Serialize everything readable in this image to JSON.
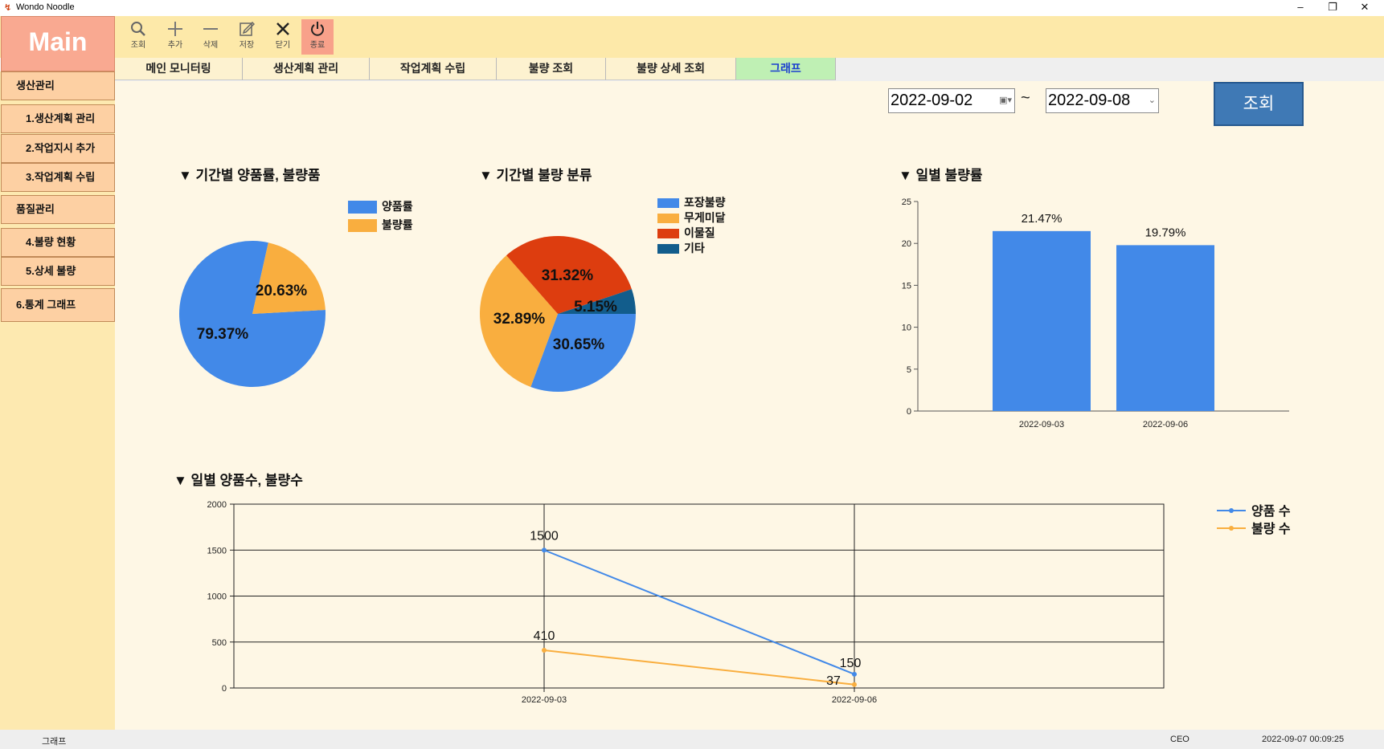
{
  "window": {
    "title": "Wondo Noodle",
    "controls": [
      "–",
      "❐",
      "✕"
    ]
  },
  "toolbar": {
    "logo": "Main",
    "buttons": [
      {
        "label": "조회",
        "icon": "search-icon"
      },
      {
        "label": "추가",
        "icon": "plus-icon"
      },
      {
        "label": "삭제",
        "icon": "minus-icon"
      },
      {
        "label": "저장",
        "icon": "save-icon"
      },
      {
        "label": "닫기",
        "icon": "close-icon"
      },
      {
        "label": "종료",
        "icon": "power-icon"
      }
    ]
  },
  "tabs": [
    {
      "label": "메인 모니터링"
    },
    {
      "label": "생산계획 관리"
    },
    {
      "label": "작업계획 수립"
    },
    {
      "label": "불량 조회"
    },
    {
      "label": "불량 상세 조회"
    },
    {
      "label": "그래프",
      "active": true
    }
  ],
  "sidebar": {
    "items": [
      {
        "label": "생산관리",
        "level": 0
      },
      {
        "label": "1.생산계획 관리",
        "level": 1
      },
      {
        "label": "2.작업지시 추가",
        "level": 1
      },
      {
        "label": "3.작업계획 수립",
        "level": 1
      },
      {
        "label": "품질관리",
        "level": 0
      },
      {
        "label": "4.불량 현황",
        "level": 1
      },
      {
        "label": "5.상세 불량",
        "level": 1
      },
      {
        "label": "6.통계 그래프",
        "level": 0
      }
    ]
  },
  "filter": {
    "start_date": "2022-09-02",
    "end_date": "2022-09-08",
    "separator": "~",
    "search_label": "조회"
  },
  "colors": {
    "blue": "#4289e8",
    "orange": "#f9ae3f",
    "red": "#dd3d0f",
    "darkblue": "#125d8c"
  },
  "chart_data": [
    {
      "type": "pie",
      "title": "▼ 기간별 양품률, 불량품",
      "labels": [
        "양품률",
        "불량률"
      ],
      "values": [
        79.37,
        20.63
      ],
      "value_labels": [
        "79.37%",
        "20.63%"
      ],
      "colors": [
        "#4289e8",
        "#f9ae3f"
      ],
      "legend": "top-right"
    },
    {
      "type": "pie",
      "title": "▼ 기간별 불량 분류",
      "labels": [
        "포장불량",
        "무게미달",
        "이물질",
        "기타"
      ],
      "values": [
        30.65,
        32.89,
        31.32,
        5.15
      ],
      "value_labels": [
        "30.65%",
        "32.89%",
        "31.32%",
        "5.15%"
      ],
      "colors": [
        "#4289e8",
        "#f9ae3f",
        "#dd3d0f",
        "#125d8c"
      ],
      "legend": "top-right"
    },
    {
      "type": "bar",
      "title": "▼ 일별 불량률",
      "categories": [
        "2022-09-03",
        "2022-09-06"
      ],
      "values": [
        21.47,
        19.79
      ],
      "value_labels": [
        "21.47%",
        "19.79%"
      ],
      "ylim": [
        0,
        25
      ],
      "yticks": [
        "0",
        "5",
        "10",
        "15",
        "20",
        "25"
      ],
      "color": "#4289e8"
    },
    {
      "type": "line",
      "title": "▼ 일별 양품수, 불량수",
      "categories": [
        "2022-09-03",
        "2022-09-06"
      ],
      "series": [
        {
          "name": "양품 수",
          "values": [
            1500,
            150
          ],
          "value_labels": [
            "1500",
            "150"
          ],
          "color": "#4289e8"
        },
        {
          "name": "불량 수",
          "values": [
            410,
            37
          ],
          "value_labels": [
            "410",
            "37"
          ],
          "color": "#f9ae3f"
        }
      ],
      "ylim": [
        0,
        2000
      ],
      "yticks": [
        "0",
        "500",
        "1000",
        "1500",
        "2000"
      ],
      "grid": true,
      "legend": "top-right"
    }
  ],
  "status": {
    "screen": "그래프",
    "user": "CEO",
    "datetime": "2022-09-07 00:09:25"
  }
}
